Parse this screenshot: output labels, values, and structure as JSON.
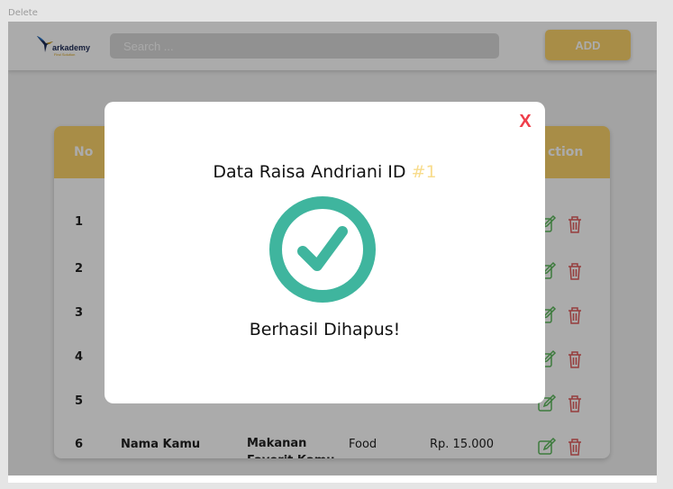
{
  "frame": {
    "label": "Delete"
  },
  "header": {
    "logo_text": "arkademy",
    "logo_subtext": "Find Solution",
    "search_placeholder": "Search ...",
    "add_label": "ADD"
  },
  "table": {
    "columns": {
      "no": "No",
      "action": "ction"
    },
    "rows": [
      {
        "no": "1"
      },
      {
        "no": "2"
      },
      {
        "no": "3"
      },
      {
        "no": "4"
      },
      {
        "no": "5"
      },
      {
        "no": "6",
        "name": "Nama Kamu",
        "food": "Makanan Favorit Kamu",
        "category": "Food",
        "price": "Rp. 15.000"
      }
    ]
  },
  "modal": {
    "close_label": "X",
    "title_prefix": "Data Raisa Andriani ID ",
    "title_id": "#1",
    "message": "Berhasil Dihapus!"
  },
  "colors": {
    "accent": "#fbd26a",
    "success": "#3fb59e",
    "danger": "#ef3e4a",
    "edit": "#5cb85c",
    "delete": "#e05a5a"
  },
  "icons": {
    "check": "check-circle-icon",
    "edit": "edit-icon",
    "delete": "trash-icon"
  }
}
